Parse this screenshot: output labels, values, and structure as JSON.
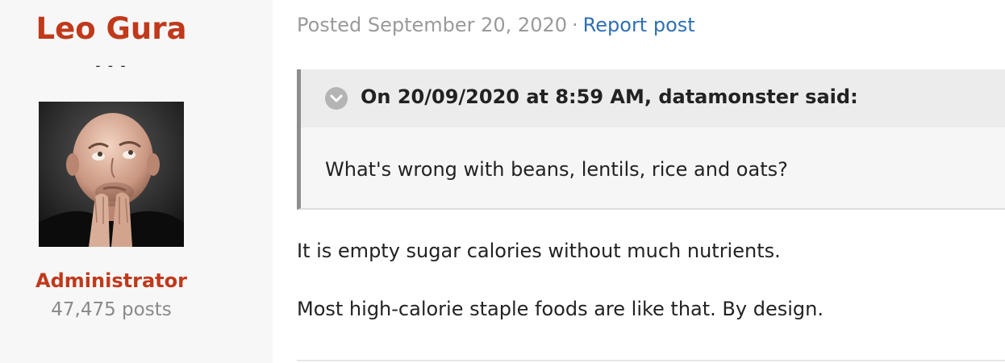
{
  "author": {
    "name": "Leo Gura",
    "title": "- - -",
    "group": "Administrator",
    "post_count": "47,475 posts"
  },
  "post": {
    "posted": "Posted September 20, 2020",
    "separator": "·",
    "report_label": "Report post",
    "quote": {
      "citation": "On 20/09/2020 at 8:59 AM, datamonster said:",
      "text": "What's wrong with beans, lentils, rice and oats?"
    },
    "paragraphs": [
      "It is empty sugar calories without much nutrients.",
      "Most high-calorie staple foods are like that. By design."
    ]
  },
  "icons": {
    "quote_toggle": "chevron-down-circle-icon"
  },
  "colors": {
    "author_accent": "#c0391b",
    "link": "#2f6fb4",
    "muted_text": "#9a9a9a",
    "body_text": "#222222",
    "sidebar_bg": "#f7f7f7",
    "quote_bg": "#f6f6f6",
    "quote_header_bg": "#ececec"
  }
}
